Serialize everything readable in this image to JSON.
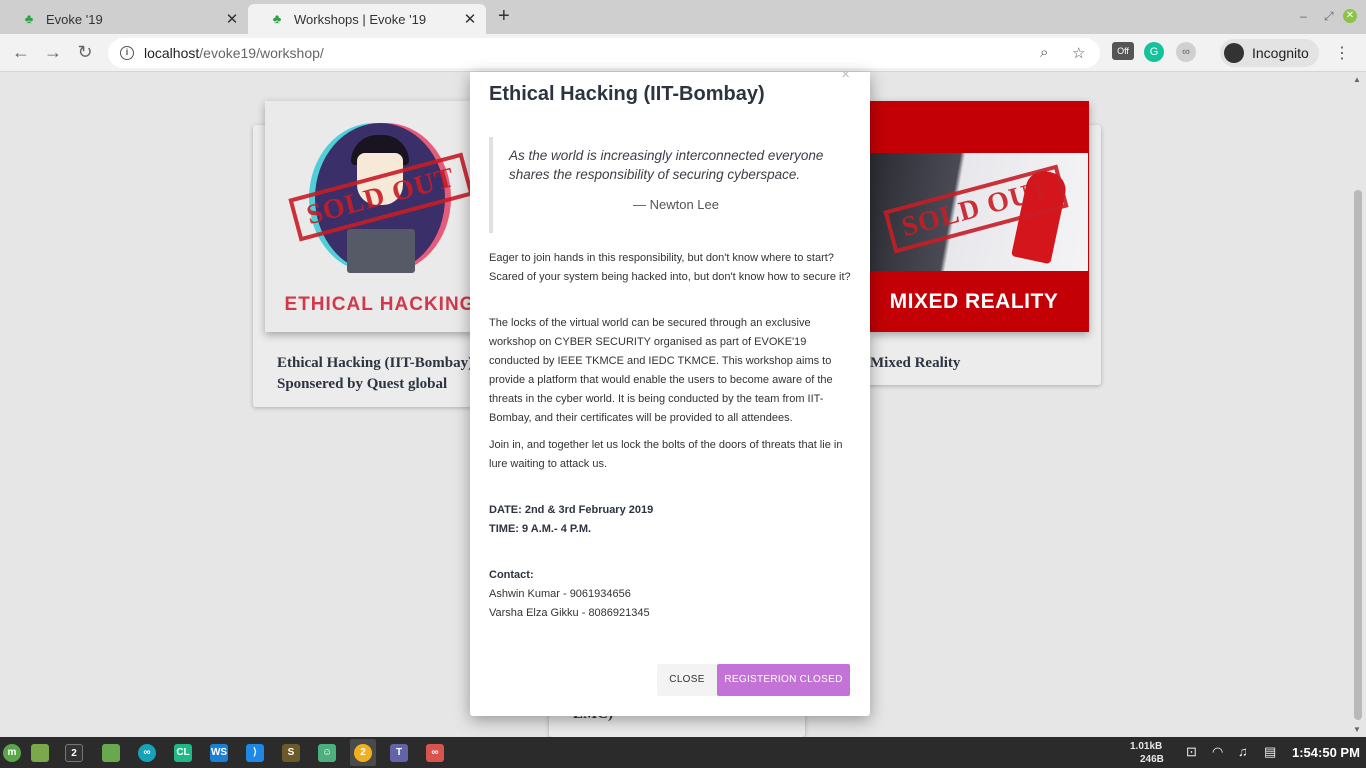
{
  "browser": {
    "tabs": [
      {
        "title": "Evoke '19",
        "favicon": "evoke-leaf-icon"
      },
      {
        "title": "Workshops | Evoke '19",
        "favicon": "evoke-leaf-icon"
      }
    ],
    "url_host": "localhost",
    "url_path": "/evoke19/workshop/",
    "incognito_label": "Incognito",
    "extension_badge": "Off"
  },
  "page": {
    "cards": [
      {
        "title_line1": "Ethical Hacking (IIT-Bombay)",
        "title_line2": "Sponsered by Quest global",
        "image_label": "ETHICAL HACKING",
        "stamp": "SOLD OUT"
      },
      {
        "title_line1": "Mixed Reality",
        "image_label": "MIXED REALITY",
        "stamp": "SOLD OUT"
      },
      {
        "title_fragment": "EMC)"
      }
    ]
  },
  "modal": {
    "title": "Ethical Hacking (IIT-Bombay)",
    "close_x": "×",
    "quote": "As the world is increasingly interconnected everyone shares the responsibility of securing cyberspace.",
    "quote_author": "— Newton Lee",
    "paragraph1": "Eager to join hands in this responsibility, but don't know where to start? Scared of your system being hacked into, but don't know how to secure it?",
    "paragraph2": "The locks of the virtual world can be secured through an exclusive workshop on CYBER SECURITY organised as part of EVOKE'19 conducted by IEEE TKMCE and IEDC TKMCE. This workshop aims to provide a platform that would enable the users to become aware of the threats in the cyber world. It is being conducted by the team from IIT-Bombay, and their certificates will be provided to all attendees.",
    "paragraph3": "Join in, and together let us lock the bolts of the doors of threats that lie in lure waiting to attack us.",
    "date": "DATE: 2nd & 3rd February 2019",
    "time": "TIME: 9 A.M.- 4 P.M.",
    "contact_heading": "Contact:",
    "contact1": "Ashwin Kumar - 9061934656",
    "contact2": "Varsha Elza Gikku - 8086921345",
    "close_button": "CLOSE",
    "register_button": "REGISTERION CLOSED",
    "register_color": "#c373d6"
  },
  "taskbar": {
    "net_down": "1.01kB",
    "net_up": "246B",
    "clock": "1:54:50 PM",
    "badge_count": "2"
  }
}
